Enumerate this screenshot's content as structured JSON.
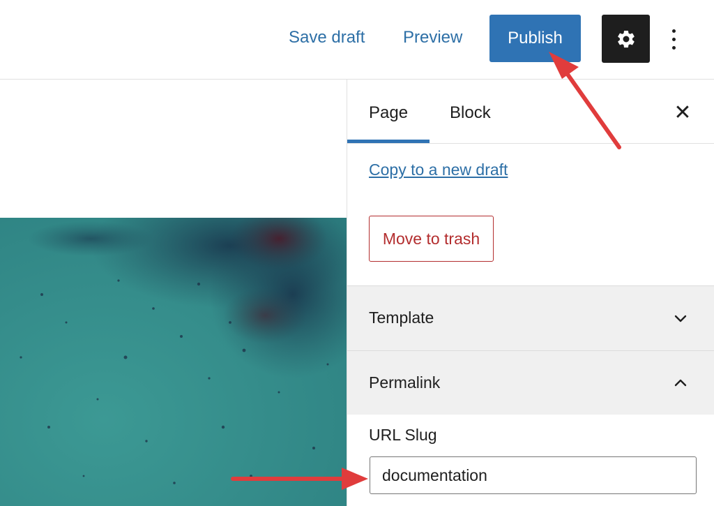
{
  "toolbar": {
    "save_draft_label": "Save draft",
    "preview_label": "Preview",
    "publish_label": "Publish",
    "settings_icon": "gear-icon",
    "more_icon": "more-vertical-icon"
  },
  "sidebar": {
    "tabs": [
      {
        "label": "Page",
        "active": true
      },
      {
        "label": "Block",
        "active": false
      }
    ],
    "close_icon": "close-icon",
    "close_glyph": "✕",
    "copy_link": "Copy to a new draft",
    "trash_label": "Move to trash",
    "panels": [
      {
        "title": "Template",
        "expanded": false
      },
      {
        "title": "Permalink",
        "expanded": true
      }
    ],
    "permalink": {
      "label": "URL Slug",
      "value": "documentation"
    }
  },
  "colors": {
    "accent": "#2f73b4",
    "danger": "#b32d2e",
    "annotation_arrow": "#e03c3c",
    "image_teal": "#358d8b"
  }
}
